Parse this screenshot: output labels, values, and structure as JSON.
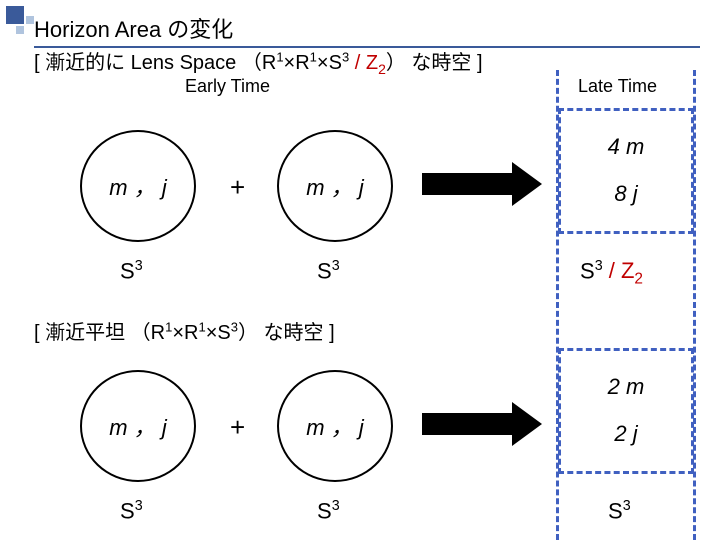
{
  "title": "Horizon Area の変化",
  "section1": {
    "heading_prefix": "[ 漸近的に Lens Space （R",
    "heading_mid1": "×R",
    "heading_mid2": "×S",
    "heading_z": " / Z",
    "heading_suffix": "） な時空 ]",
    "early_label": "Early Time",
    "late_label": "Late Time",
    "bubble_left": "m ， j",
    "bubble_right": "m ， j",
    "plus": "+",
    "s_left": "S",
    "s_right": "S",
    "late_top": "4 m",
    "late_bottom": "8 j",
    "late_s_prefix": "S",
    "late_s_mid": " / Z"
  },
  "section2": {
    "heading_prefix": "[ 漸近平坦 （R",
    "heading_mid1": "×R",
    "heading_mid2": "×S",
    "heading_suffix": "） な時空 ]",
    "bubble_left": "m ， j",
    "bubble_right": "m ， j",
    "plus": "+",
    "s_left": "S",
    "s_right": "S",
    "late_top": "2 m",
    "late_bottom": "2 j",
    "late_s": "S"
  },
  "exp1": "1",
  "exp3": "3",
  "sub2": "2"
}
